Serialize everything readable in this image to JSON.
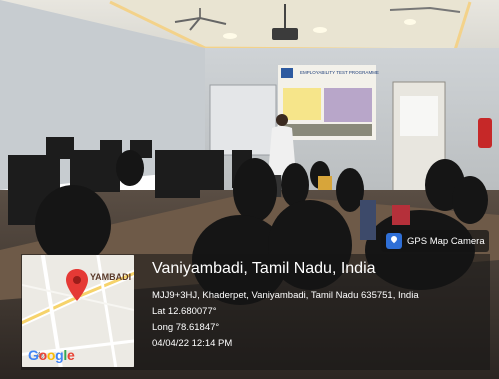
{
  "badge": {
    "label": "GPS Map Camera",
    "icon": "gps-map-camera-icon"
  },
  "location": {
    "title": "Vaniyambadi, Tamil Nadu, India",
    "address": "MJJ9+3HJ, Khaderpet, Vaniyambadi, Tamil Nadu 635751, India",
    "lat": "Lat 12.680077°",
    "long": "Long 78.61847°",
    "datetime": "04/04/22 12:14 PM"
  },
  "map": {
    "place_label": "YAMBADI",
    "logo": "Google",
    "pin_color": "#e53935"
  },
  "slide": {
    "title": "EMPLOYABILITY TEST PROGRAMME"
  }
}
